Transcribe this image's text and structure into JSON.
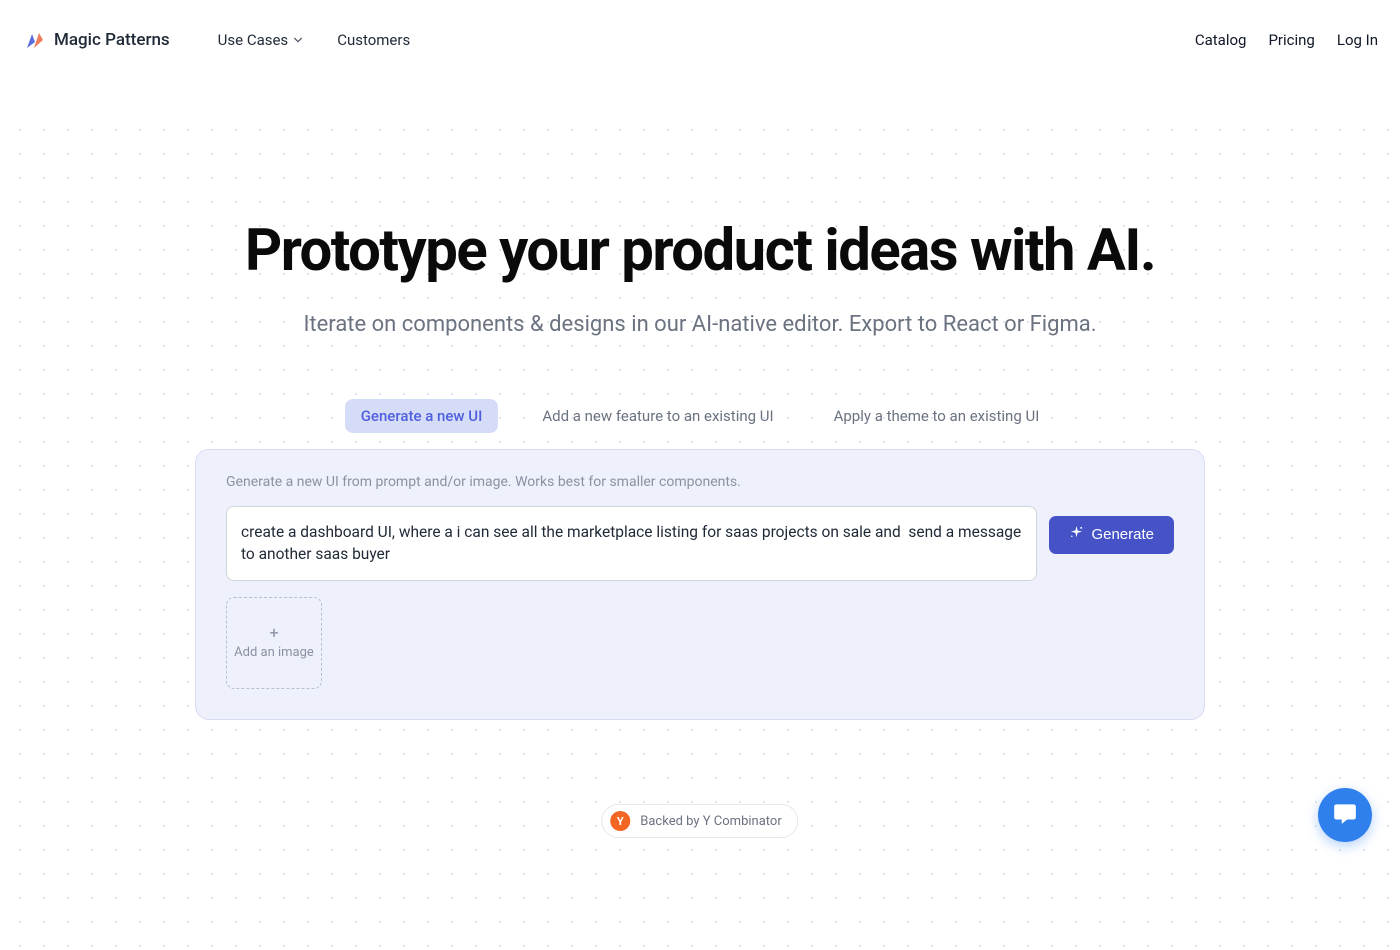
{
  "brand": {
    "name": "Magic Patterns"
  },
  "nav": {
    "use_cases": "Use Cases",
    "customers": "Customers",
    "catalog": "Catalog",
    "pricing": "Pricing",
    "login": "Log In"
  },
  "hero": {
    "title": "Prototype your product ideas with AI.",
    "subtitle": "Iterate on components & designs in our AI-native editor. Export to React or Figma."
  },
  "tabs": {
    "generate": "Generate a new UI",
    "add_feature": "Add a new feature to an existing UI",
    "apply_theme": "Apply a theme to an existing UI"
  },
  "prompt": {
    "instruction": "Generate a new UI from prompt and/or image. Works best for smaller components.",
    "value": "create a dashboard UI, where a i can see all the marketplace listing for saas projects on sale and  send a message to another saas buyer",
    "generate_label": "Generate",
    "add_image_label": "Add an image"
  },
  "badge": {
    "yc_letter": "Y",
    "text": "Backed by Y Combinator"
  }
}
